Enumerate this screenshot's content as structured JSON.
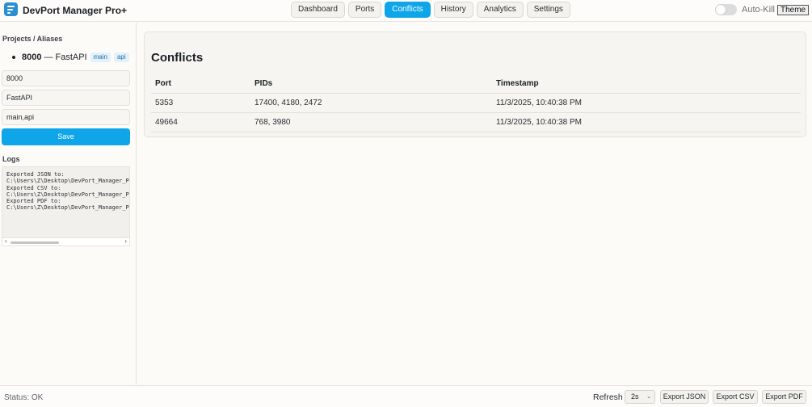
{
  "app": {
    "title": "DevPort Manager Pro+"
  },
  "nav": {
    "tabs": [
      {
        "label": "Dashboard"
      },
      {
        "label": "Ports"
      },
      {
        "label": "Conflicts",
        "active": true
      },
      {
        "label": "History"
      },
      {
        "label": "Analytics"
      },
      {
        "label": "Settings"
      }
    ]
  },
  "header": {
    "autokill_label": "Auto-Kill",
    "autokill_on": false,
    "theme_label": "Theme"
  },
  "sidebar": {
    "projects_title": "Projects / Aliases",
    "alias": {
      "port": "8000",
      "separator": "—",
      "name": "FastAPI",
      "tags": [
        "main",
        "api"
      ]
    },
    "form": {
      "port_value": "8000",
      "name_value": "FastAPI",
      "tags_value": "main,api",
      "save_label": "Save"
    },
    "logs_title": "Logs",
    "logs": [
      "Exported JSON to:",
      "C:\\Users\\Z\\Desktop\\DevPort_Manager_Pro",
      "Exported CSV to:",
      "C:\\Users\\Z\\Desktop\\DevPort_Manager_Pro",
      "Exported PDF to:",
      "C:\\Users\\Z\\Desktop\\DevPort_Manager_Pro"
    ]
  },
  "conflicts": {
    "title": "Conflicts",
    "columns": [
      "Port",
      "PIDs",
      "Timestamp"
    ],
    "rows": [
      {
        "port": "5353",
        "pids": "17400, 4180, 2472",
        "timestamp": "11/3/2025, 10:40:38 PM"
      },
      {
        "port": "49664",
        "pids": "768, 3980",
        "timestamp": "11/3/2025, 10:40:38 PM"
      }
    ]
  },
  "footer": {
    "status": "Status: OK",
    "refresh_label": "Refresh",
    "refresh_value": "2s",
    "export_json": "Export JSON",
    "export_csv": "Export CSV",
    "export_pdf": "Export PDF"
  },
  "colors": {
    "accent": "#0ea5e9",
    "logo": "#2a8fd0"
  }
}
